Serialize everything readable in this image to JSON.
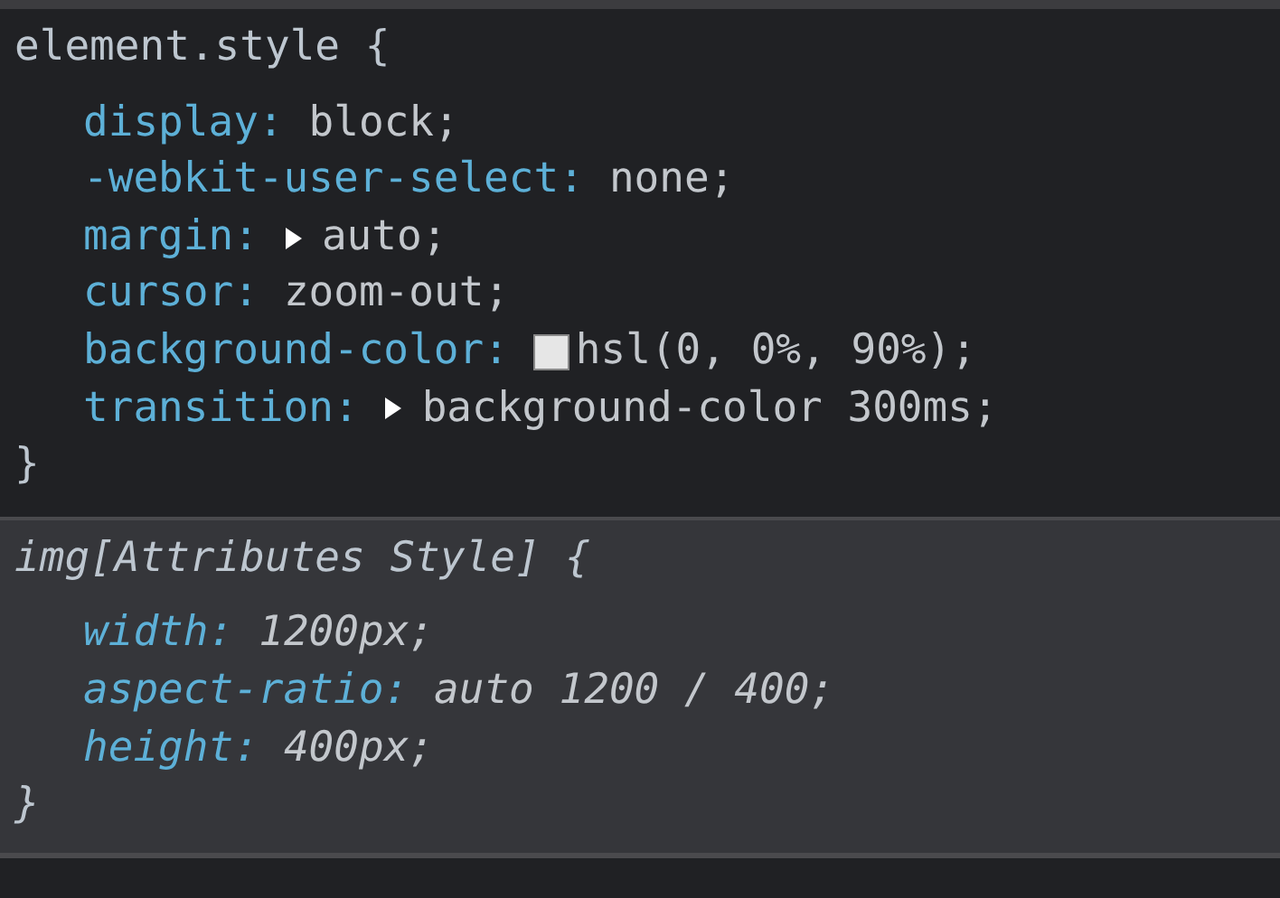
{
  "rules": [
    {
      "kind": "inline",
      "selector": "element.style {",
      "declarations": [
        {
          "kind": "plain",
          "property": "display:",
          "value": "block;"
        },
        {
          "kind": "plain",
          "property": "-webkit-user-select:",
          "value": "none;"
        },
        {
          "kind": "expandable",
          "property": "margin:",
          "value": "auto;"
        },
        {
          "kind": "plain",
          "property": "cursor:",
          "value": "zoom-out;"
        },
        {
          "kind": "swatch",
          "property": "background-color:",
          "value": "hsl(0, 0%, 90%);"
        },
        {
          "kind": "expandable",
          "property": "transition:",
          "value": "background-color 300ms;"
        }
      ],
      "closing": "}"
    },
    {
      "kind": "user-agent",
      "selector": "img[Attributes Style] {",
      "declarations": [
        {
          "kind": "plain",
          "property": "width:",
          "value": "1200px;"
        },
        {
          "kind": "plain",
          "property": "aspect-ratio:",
          "value": "auto 1200 / 400;"
        },
        {
          "kind": "plain",
          "property": "height:",
          "value": "400px;"
        }
      ],
      "closing": "}"
    }
  ]
}
